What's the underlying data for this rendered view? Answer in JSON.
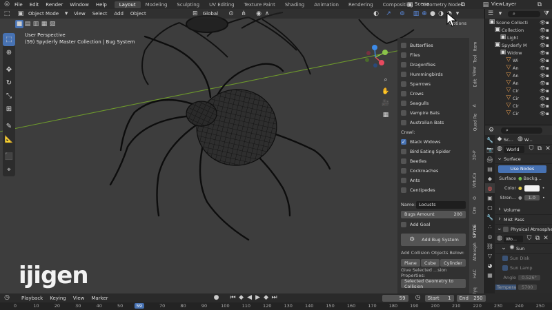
{
  "topbar": {
    "menus": [
      "File",
      "Edit",
      "Render",
      "Window",
      "Help"
    ],
    "workspaces": [
      "Layout",
      "Modeling",
      "Sculpting",
      "UV Editing",
      "Texture Paint",
      "Shading",
      "Animation",
      "Rendering",
      "Compositing",
      "Geometry Nodes"
    ],
    "active_workspace": "Layout",
    "scene": "Scene",
    "view_layer": "ViewLayer"
  },
  "viewport": {
    "mode": "Object Mode",
    "menus": [
      "View",
      "Select",
      "Add",
      "Object"
    ],
    "orientation": "Global",
    "options_label": "Options",
    "perspective": "User Perspective",
    "collection_info": "(59) Spyderfy Master Collection | Bug System",
    "grid_line_color": "#6e9a2c"
  },
  "bug_panel": {
    "flying": [
      {
        "label": "Butterflies",
        "checked": false
      },
      {
        "label": "Flies",
        "checked": false
      },
      {
        "label": "Dragonflies",
        "checked": false
      },
      {
        "label": "Hummingbirds",
        "checked": false
      },
      {
        "label": "Sparrows",
        "checked": false
      },
      {
        "label": "Crows",
        "checked": false
      },
      {
        "label": "Seagulls",
        "checked": false
      },
      {
        "label": "Vampire Bats",
        "checked": false
      },
      {
        "label": "Australian Bats",
        "checked": false
      }
    ],
    "crawl_label": "Crawl:",
    "crawl": [
      {
        "label": "Black Widows",
        "checked": true
      },
      {
        "label": "Bird Eating Spider",
        "checked": false
      },
      {
        "label": "Beetles",
        "checked": false
      },
      {
        "label": "Cockroaches",
        "checked": false
      },
      {
        "label": "Ants",
        "checked": false
      },
      {
        "label": "Centipedes",
        "checked": false
      }
    ],
    "name_label": "Name:",
    "name_value": "Locusts",
    "amount_label": "Bugs Amount",
    "amount_value": "200",
    "add_goal": "Add Goal",
    "add_bug_system": "Add Bug System",
    "collision_note": "Add Collision Objects Below:",
    "plane": "Plane",
    "cube": "Cube",
    "cylinder": "Cylinder",
    "selected_note": "Give Selected ...sion Properties:",
    "selected_btn": "Selected Geometry to Collision"
  },
  "side_tabs": [
    "Item",
    "Tool",
    "View",
    "Edit",
    "A",
    "Quad Re",
    "3D-P",
    "VirtuCa",
    "O",
    "Cre",
    "SPYDE",
    "Atmosph",
    "HAC",
    "polyq"
  ],
  "outliner": {
    "items": [
      {
        "label": "Scene Collecti",
        "indent": 0
      },
      {
        "label": "Collection",
        "indent": 1
      },
      {
        "label": "Light",
        "indent": 2
      },
      {
        "label": "Spyderfy M",
        "indent": 1
      },
      {
        "label": "Widow",
        "indent": 2
      },
      {
        "label": "Wi",
        "indent": 3
      },
      {
        "label": "An",
        "indent": 3
      },
      {
        "label": "An",
        "indent": 3
      },
      {
        "label": "An",
        "indent": 3
      },
      {
        "label": "Cir",
        "indent": 3
      },
      {
        "label": "Cir",
        "indent": 3
      },
      {
        "label": "Cir",
        "indent": 3
      },
      {
        "label": "Cir",
        "indent": 3
      }
    ]
  },
  "properties": {
    "breadcrumb_scene": "Sc...",
    "breadcrumb_world": "W...",
    "world_name": "World",
    "surface_section": "Surface",
    "use_nodes": "Use Nodes",
    "surface_label": "Surface",
    "surface_value": "Backg...",
    "color_label": "Color",
    "strength_label": "Stren...",
    "strength_value": "1.0",
    "volume": "Volume",
    "mist_pass": "Mist Pass",
    "physical_atmo": "Physical Atmospher",
    "wo_label": "Wo...",
    "sun": "Sun",
    "sun_disk": "Sun Disk",
    "sun_lamp": "Sun Lamp",
    "angle_label": "Angle",
    "angle_value": "0.526°",
    "temp_label": "Tempera",
    "temp_value": "5700"
  },
  "timeline": {
    "menus": [
      "Playback",
      "Keying",
      "View",
      "Marker"
    ],
    "current_frame": "59",
    "start_label": "Start",
    "start": "1",
    "end_label": "End",
    "end": "250",
    "ticks": [
      "0",
      "10",
      "20",
      "30",
      "40",
      "50",
      "59",
      "70",
      "80",
      "90",
      "100",
      "110",
      "120",
      "130",
      "140",
      "150",
      "160",
      "170",
      "180",
      "190",
      "200",
      "210",
      "220",
      "230",
      "240",
      "250"
    ]
  },
  "watermark": "ijigen",
  "colors": {
    "accent": "#4772b3",
    "x_axis": "#e84a5f",
    "y_axis": "#8bc34a",
    "z_axis": "#3d8be8"
  }
}
